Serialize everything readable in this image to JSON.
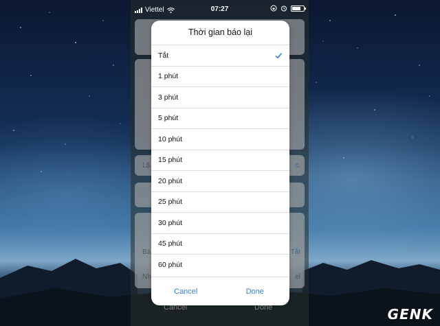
{
  "status_bar": {
    "carrier": "Viettel",
    "time": "07:27"
  },
  "background": {
    "row_lap_label": "Lặ",
    "row_lap_value": "c.",
    "row_ba_label": "Bá",
    "row_ba_value": "Tắt",
    "row_nh_label": "Nh",
    "row_nh_value": "el",
    "footer_cancel": "Cancel",
    "footer_done": "Done"
  },
  "dialog": {
    "title": "Thời gian báo lại",
    "options": [
      {
        "label": "Tắt",
        "selected": true
      },
      {
        "label": "1 phút",
        "selected": false
      },
      {
        "label": "3 phút",
        "selected": false
      },
      {
        "label": "5 phút",
        "selected": false
      },
      {
        "label": "10 phút",
        "selected": false
      },
      {
        "label": "15 phút",
        "selected": false
      },
      {
        "label": "20 phút",
        "selected": false
      },
      {
        "label": "25 phút",
        "selected": false
      },
      {
        "label": "30 phút",
        "selected": false
      },
      {
        "label": "45 phút",
        "selected": false
      },
      {
        "label": "60 phút",
        "selected": false
      }
    ],
    "cancel_label": "Cancel",
    "done_label": "Done"
  },
  "watermark": "GENK",
  "colors": {
    "accent": "#3d7fc1",
    "dialog_bg": "#ffffff",
    "divider": "#dcdcdc"
  },
  "icons": [
    "signal-icon",
    "wifi-icon",
    "rotation-lock-icon",
    "alarm-icon",
    "battery-icon",
    "checkmark-icon"
  ]
}
